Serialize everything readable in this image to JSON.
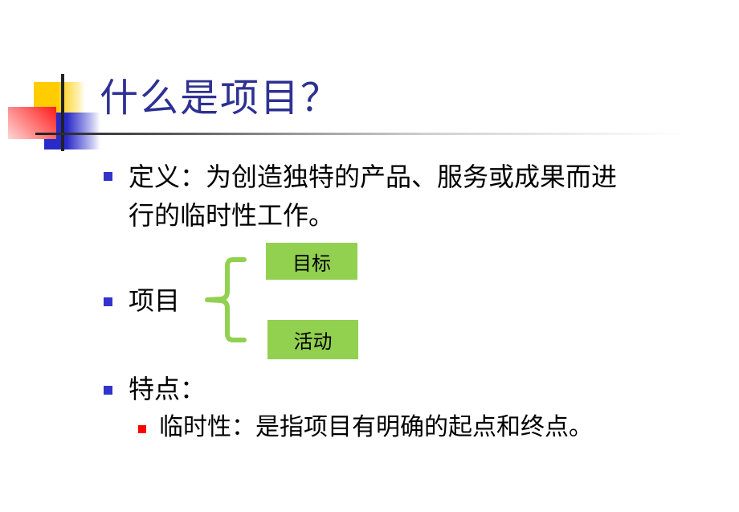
{
  "slide": {
    "title": "什么是项目？",
    "bullets": [
      {
        "line1": "定义：为创造独特的产品、服务或成果而进",
        "line2": "行的临时性工作。"
      },
      {
        "label": "项目",
        "branches": [
          "目标",
          "活动"
        ]
      },
      {
        "label": "特点：",
        "sub_items": [
          "临时性：是指项目有明确的起点和终点。"
        ]
      }
    ]
  },
  "colors": {
    "title": "#2e3192",
    "bullet_primary": "#3333cc",
    "bullet_secondary": "#ff0000",
    "branch_box": "#92d050",
    "brace": "#92d050"
  }
}
